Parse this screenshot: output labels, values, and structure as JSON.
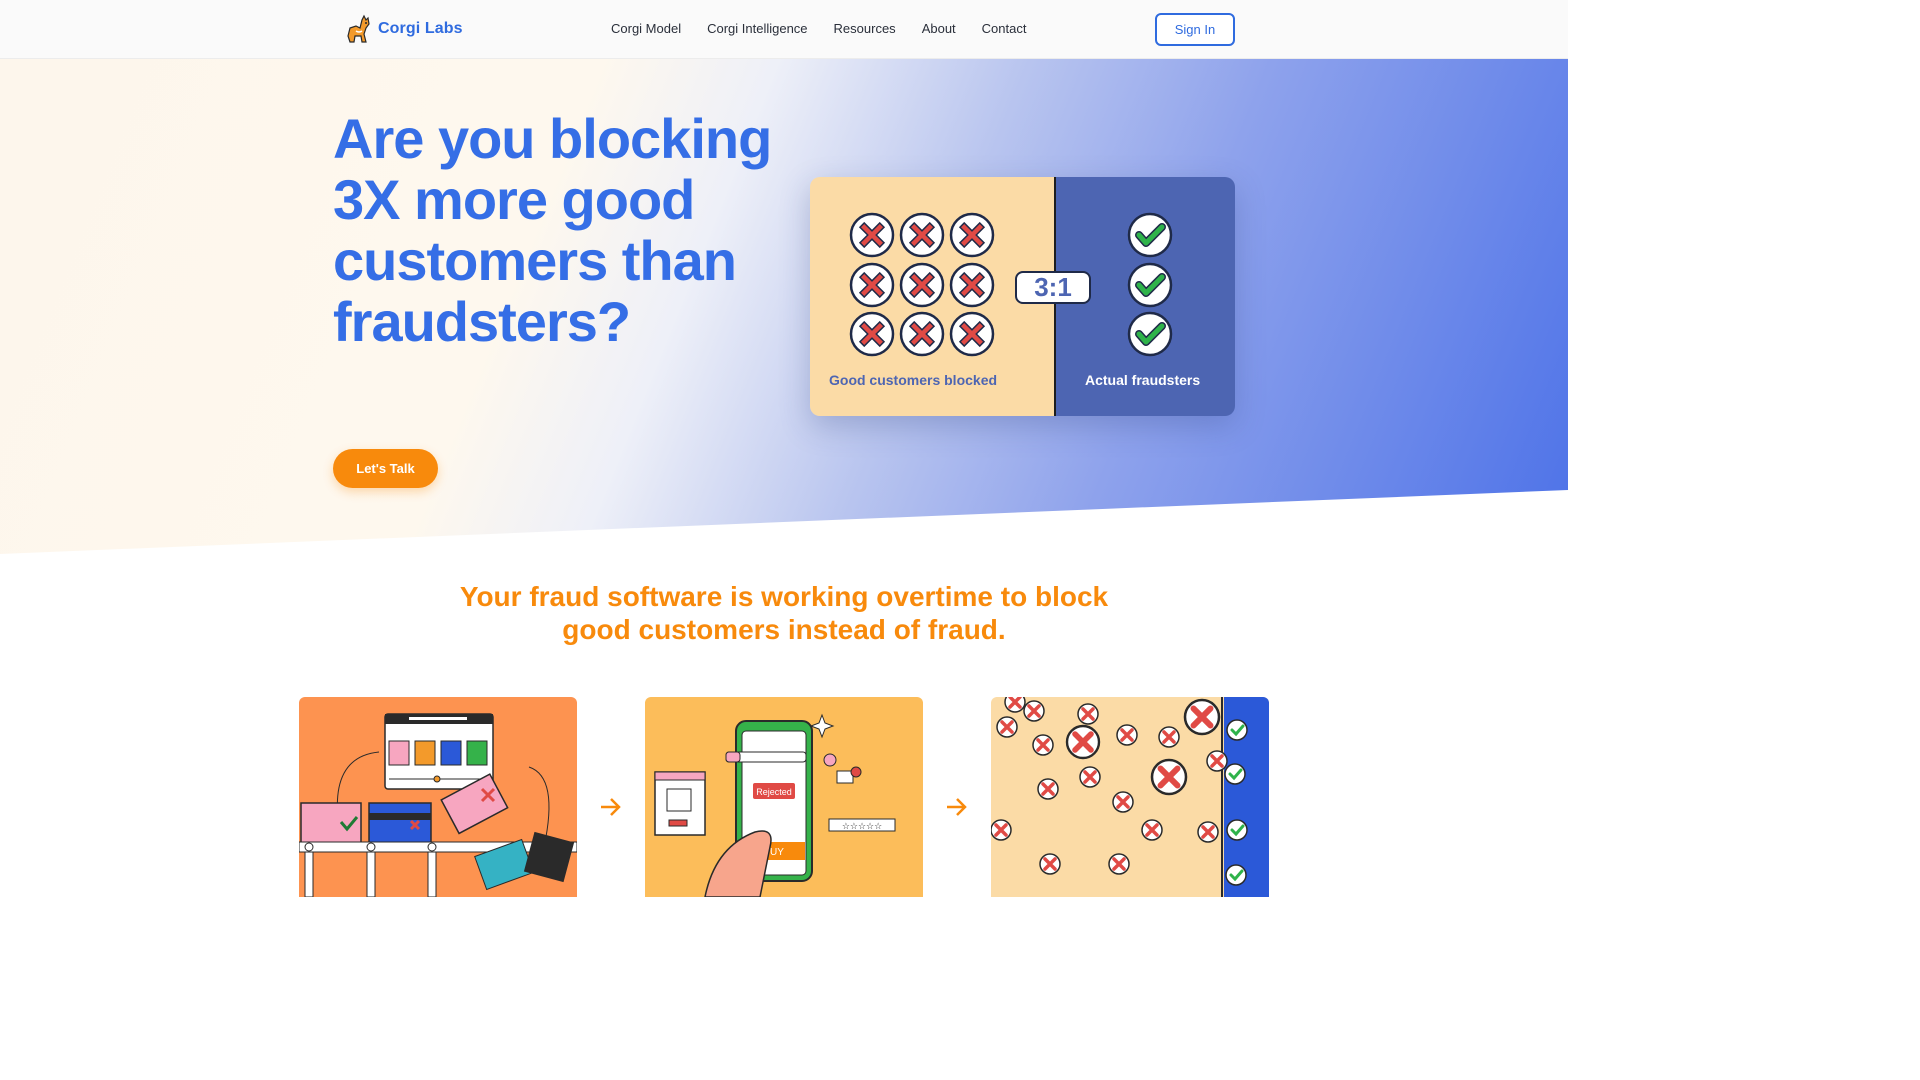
{
  "nav": {
    "logo_text": "Corgi Labs",
    "links": [
      "Corgi Model",
      "Corgi Intelligence",
      "Resources",
      "About",
      "Contact"
    ],
    "sign_in": "Sign In"
  },
  "hero": {
    "title": "Are you blocking 3X more good customers than fraudsters?",
    "cta": "Let's Talk",
    "card": {
      "ratio": "3:1",
      "left_label": "Good customers blocked",
      "right_label": "Actual fraudsters"
    }
  },
  "section": {
    "tagline": "Your fraud software is working overtime to block good customers instead of fraud.",
    "panel2_badge": "Rejected",
    "panel2_buy": "UY"
  },
  "colors": {
    "brand_blue": "#356ee6",
    "accent_orange": "#f88a0c",
    "card_left": "#fbdba6",
    "card_right": "#4d65b2"
  }
}
